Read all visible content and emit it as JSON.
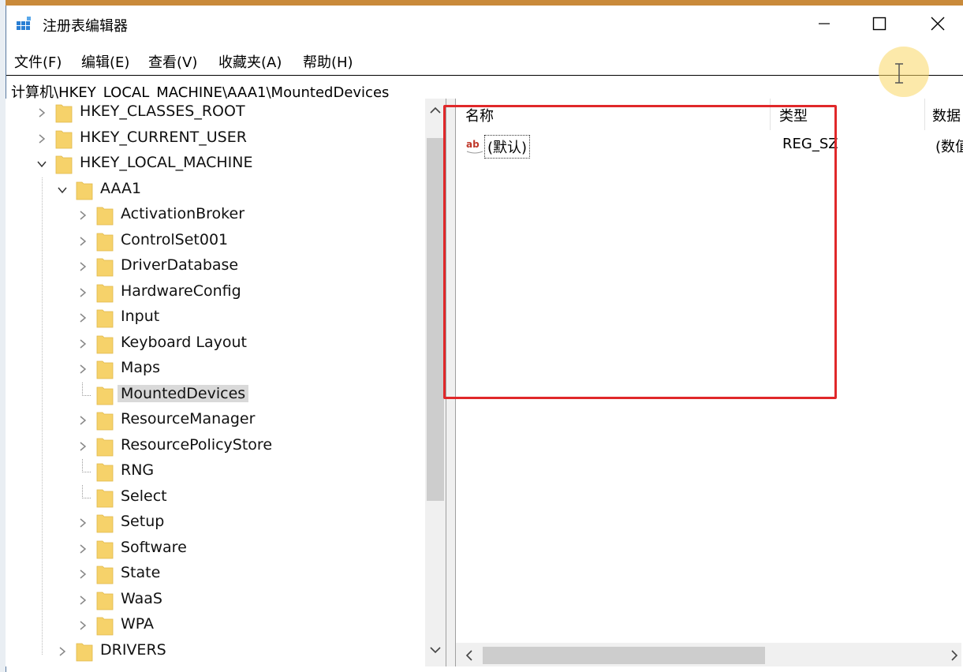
{
  "window": {
    "title": "注册表编辑器",
    "controls": {
      "minimize": "minimize",
      "maximize": "maximize",
      "close": "close"
    }
  },
  "menu": [
    "文件(F)",
    "编辑(E)",
    "查看(V)",
    "收藏夹(A)",
    "帮助(H)"
  ],
  "address": "计算机\\HKEY_LOCAL_MACHINE\\AAA1\\MountedDevices",
  "tree": {
    "roots": [
      "HKEY_CLASSES_ROOT",
      "HKEY_CURRENT_USER",
      "HKEY_LOCAL_MACHINE"
    ],
    "hive": "AAA1",
    "children": [
      "ActivationBroker",
      "ControlSet001",
      "DriverDatabase",
      "HardwareConfig",
      "Input",
      "Keyboard Layout",
      "Maps",
      "MountedDevices",
      "ResourceManager",
      "ResourcePolicyStore",
      "RNG",
      "Select",
      "Setup",
      "Software",
      "State",
      "WaaS",
      "WPA"
    ],
    "selected": "MountedDevices",
    "after": "DRIVERS"
  },
  "list": {
    "columns": [
      "名称",
      "类型",
      "数据"
    ],
    "rows": [
      {
        "name": "(默认)",
        "type": "REG_SZ",
        "data": "(数值未设置)"
      }
    ]
  },
  "colors": {
    "highlight_box": "#e0282a",
    "folder": "#f6d26a",
    "selection": "#d9d9d9"
  }
}
